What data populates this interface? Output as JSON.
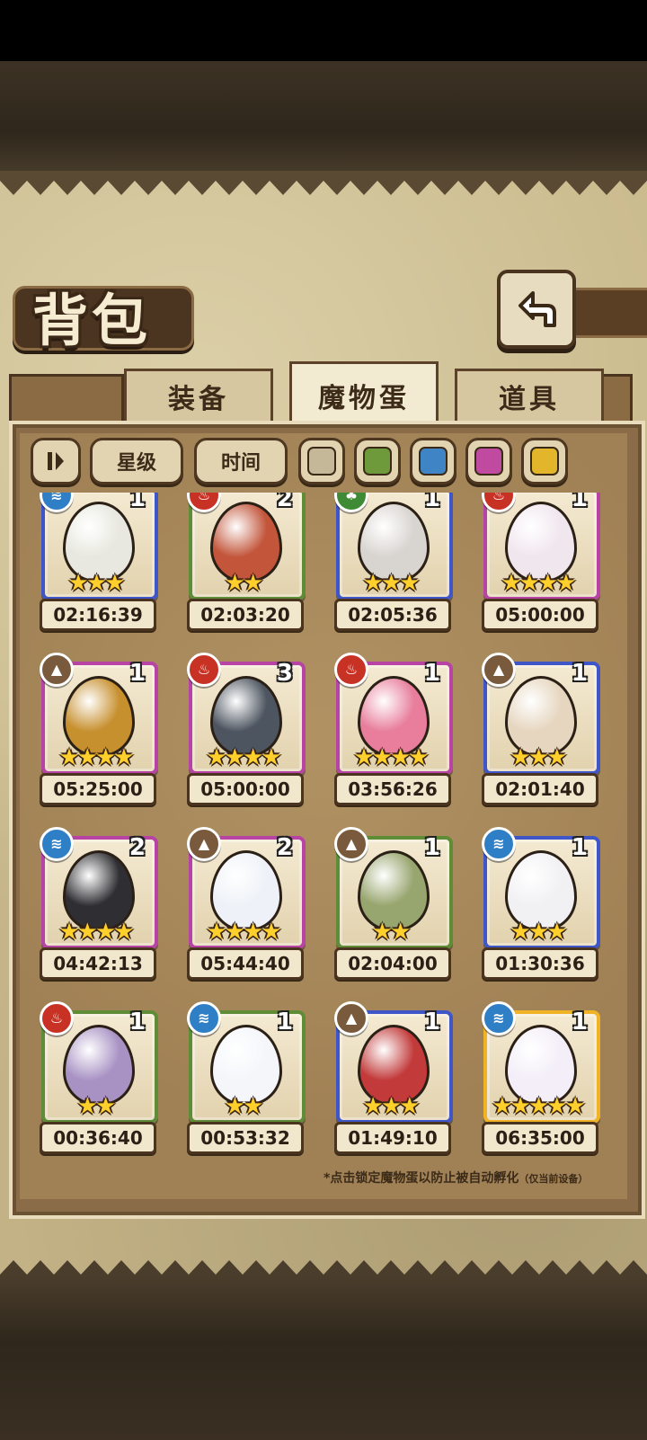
{
  "header": {
    "title": "背包"
  },
  "tabs": [
    {
      "label": "装备",
      "active": false
    },
    {
      "label": "魔物蛋",
      "active": true
    },
    {
      "label": "道具",
      "active": false
    }
  ],
  "filters": {
    "sort_icon": "sort-toggle-icon",
    "star_label": "星级",
    "time_label": "时间",
    "color_swatches": [
      "#c4b899",
      "#6e9a3b",
      "#3f85c6",
      "#c04aa0",
      "#e3b52a"
    ]
  },
  "eggs": [
    {
      "count": "1",
      "element": "water",
      "stars": 3,
      "rarity": "blue",
      "timer": "02:16:39",
      "egg_color": "#e8e8e0"
    },
    {
      "count": "2",
      "element": "fire",
      "stars": 2,
      "rarity": "green",
      "timer": "02:03:20",
      "egg_color": "#c2553a"
    },
    {
      "count": "1",
      "element": "wood",
      "stars": 3,
      "rarity": "blue",
      "timer": "02:05:36",
      "egg_color": "#d8d4d0"
    },
    {
      "count": "1",
      "element": "fire",
      "stars": 4,
      "rarity": "purple",
      "timer": "05:00:00",
      "egg_color": "#f0e6ee"
    },
    {
      "count": "1",
      "element": "earth",
      "stars": 4,
      "rarity": "purple",
      "timer": "05:25:00",
      "egg_color": "#c7902f"
    },
    {
      "count": "3",
      "element": "fire",
      "stars": 4,
      "rarity": "purple",
      "timer": "05:00:00",
      "egg_color": "#4d5560"
    },
    {
      "count": "1",
      "element": "fire",
      "stars": 4,
      "rarity": "purple",
      "timer": "03:56:26",
      "egg_color": "#e87e9c"
    },
    {
      "count": "1",
      "element": "earth",
      "stars": 3,
      "rarity": "blue",
      "timer": "02:01:40",
      "egg_color": "#e6d6bf"
    },
    {
      "count": "2",
      "element": "water",
      "stars": 4,
      "rarity": "purple",
      "timer": "04:42:13",
      "egg_color": "#2f2f33"
    },
    {
      "count": "2",
      "element": "earth",
      "stars": 4,
      "rarity": "purple",
      "timer": "05:44:40",
      "egg_color": "#eef2f8"
    },
    {
      "count": "1",
      "element": "earth",
      "stars": 2,
      "rarity": "green",
      "timer": "02:04:00",
      "egg_color": "#97a56e"
    },
    {
      "count": "1",
      "element": "water",
      "stars": 3,
      "rarity": "blue",
      "timer": "01:30:36",
      "egg_color": "#f1f1f4"
    },
    {
      "count": "1",
      "element": "fire",
      "stars": 2,
      "rarity": "green",
      "timer": "00:36:40",
      "egg_color": "#a892c4"
    },
    {
      "count": "1",
      "element": "water",
      "stars": 2,
      "rarity": "green",
      "timer": "00:53:32",
      "egg_color": "#f4f6fa"
    },
    {
      "count": "1",
      "element": "earth",
      "stars": 3,
      "rarity": "blue",
      "timer": "01:49:10",
      "egg_color": "#c23a3a"
    },
    {
      "count": "1",
      "element": "water",
      "stars": 5,
      "rarity": "gold",
      "timer": "06:35:00",
      "egg_color": "#f3eef8"
    }
  ],
  "footer_note": {
    "main": "*点击锁定魔物蛋以防止被自动孵化",
    "sub": "（仅当前设备）"
  },
  "colors": {
    "rarity_blue": "#3f56c9",
    "rarity_green": "#5f8c36",
    "rarity_purple": "#b743a5",
    "rarity_gold": "#f0b325",
    "element_water": "#2f7fc7",
    "element_fire": "#c83225",
    "element_wood": "#3f8a34",
    "element_earth": "#7a5a3c"
  }
}
